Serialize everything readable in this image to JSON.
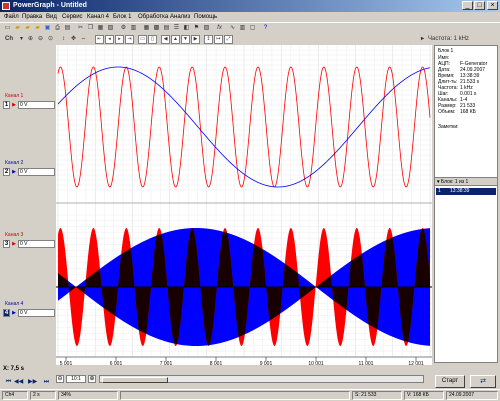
{
  "window": {
    "title": "PowerGraph - Untitled"
  },
  "menu": [
    "Файл",
    "Правка",
    "Вид",
    "Сервис",
    "Канал 4",
    "Блок 1",
    "Обработка",
    "Анализ",
    "Помощь"
  ],
  "toolbar2": {
    "ch_label": "Ch",
    "freq_label": "Частота: 1 kHz"
  },
  "channels": [
    {
      "label": "Канал 1",
      "num": "1",
      "value": "0 V",
      "color": "#ff0000"
    },
    {
      "label": "Канал 2",
      "num": "2",
      "value": "0 V",
      "color": "#0000ff"
    },
    {
      "label": "Канал 3",
      "num": "3",
      "value": "0 V",
      "color": "#ff0000"
    },
    {
      "label": "Канал 4",
      "num": "4",
      "value": "0 V",
      "color": "#0000ff"
    }
  ],
  "y_axis_top": [
    "22",
    "20",
    "18",
    "16",
    "14",
    "12",
    "10",
    "8"
  ],
  "y_axis_bottom": [
    "6",
    "4",
    "2",
    "0",
    "-2",
    "-4",
    "-6"
  ],
  "x_axis": [
    "5 001",
    "6 001",
    "7 001",
    "8 001",
    "9 001",
    "10 001",
    "11 001",
    "12 001"
  ],
  "info": {
    "header": "Блок 1",
    "rows": [
      {
        "k": "Имя:",
        "v": ""
      },
      {
        "k": "АЦП:",
        "v": "F-Generator"
      },
      {
        "k": "Дата:",
        "v": "24.09.2007"
      },
      {
        "k": "Время:",
        "v": "13:38:39"
      },
      {
        "k": "Длит-ть:",
        "v": "21.533 s"
      },
      {
        "k": "Частота:",
        "v": "1 kHz"
      },
      {
        "k": "Шаг:",
        "v": "0.001 s"
      },
      {
        "k": "Каналы:",
        "v": "1-4"
      },
      {
        "k": "Размер:",
        "v": "21 533"
      },
      {
        "k": "Объем:",
        "v": "168 КБ"
      }
    ],
    "notes": "Заметки:"
  },
  "block_list": {
    "header": "Блок: 1 из 1",
    "rows": [
      {
        "n": "1",
        "time": "13:38:39"
      }
    ]
  },
  "x_readout": "X: 7,5 s",
  "zoom": "10:1",
  "start_button": "Старт",
  "status": {
    "ch": "Ch4",
    "scale": "2 s",
    "percent": "34%",
    "samples": "S: 21 533",
    "volume": "V: 168 КБ",
    "date": "24.09.2007"
  }
}
